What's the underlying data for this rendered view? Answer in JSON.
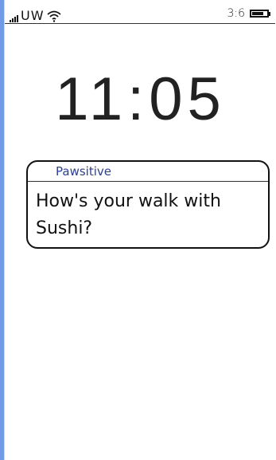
{
  "status_bar": {
    "carrier": "UW",
    "time": "3:6",
    "battery_level": 0.8,
    "signal_icon": "signal-bars-icon",
    "wifi_icon": "wifi-icon",
    "battery_icon": "battery-icon"
  },
  "lock_screen": {
    "clock": "11:05"
  },
  "notification": {
    "app_name": "Pawsitive",
    "message": "How's your walk with Sushi?"
  }
}
